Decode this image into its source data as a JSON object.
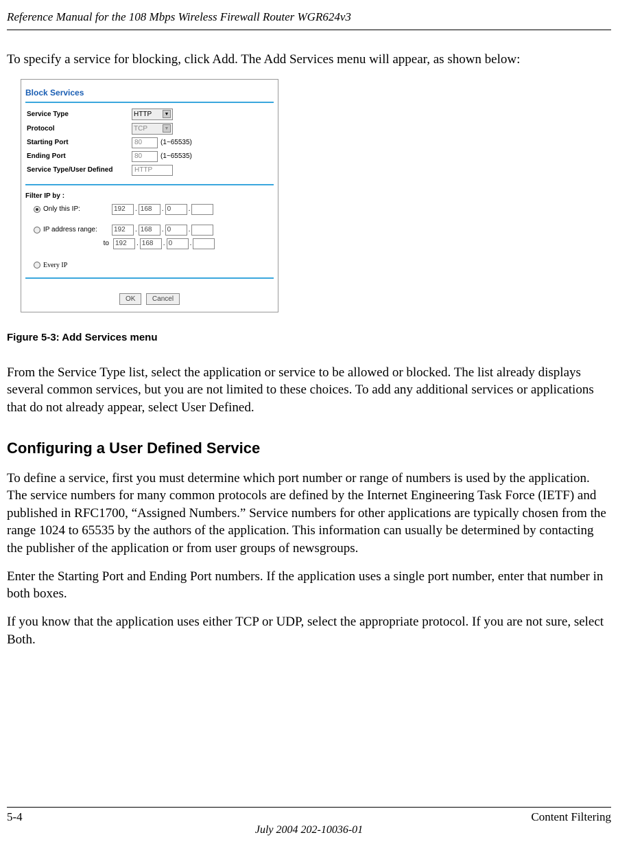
{
  "header": {
    "title": "Reference Manual for the 108 Mbps Wireless Firewall Router WGR624v3"
  },
  "intro_text": "To specify a service for blocking, click Add. The Add Services menu will appear, as shown below:",
  "figure": {
    "title": "Block Services",
    "rows": {
      "service_type": {
        "label": "Service Type",
        "value": "HTTP"
      },
      "protocol": {
        "label": "Protocol",
        "value": "TCP"
      },
      "starting_port": {
        "label": "Starting Port",
        "value": "80",
        "range": "(1~65535)"
      },
      "ending_port": {
        "label": "Ending Port",
        "value": "80",
        "range": "(1~65535)"
      },
      "user_defined": {
        "label": "Service Type/User Defined",
        "value": "HTTP"
      }
    },
    "filter": {
      "title": "Filter IP by :",
      "only_this": {
        "label": "Only this IP:",
        "oct1": "192",
        "oct2": "168",
        "oct3": "0",
        "oct4": ""
      },
      "range": {
        "label": "IP address range:",
        "from": {
          "oct1": "192",
          "oct2": "168",
          "oct3": "0",
          "oct4": ""
        },
        "to_label": "to",
        "to": {
          "oct1": "192",
          "oct2": "168",
          "oct3": "0",
          "oct4": ""
        }
      },
      "every": {
        "label": "Every IP"
      }
    },
    "buttons": {
      "ok": "OK",
      "cancel": "Cancel"
    }
  },
  "figure_caption": "Figure 5-3:  Add Services menu",
  "para_after_figure": "From the Service Type list, select the application or service to be allowed or blocked. The list already displays several common services, but you are not limited to these choices. To add any additional services or applications that do not already appear, select User Defined.",
  "section_heading": "Configuring a User Defined Service",
  "para_section_1": "To define a service, first you must determine which port number or range of numbers is used by the application. The service numbers for many common protocols are defined by the Internet Engineering Task Force (IETF) and published in RFC1700, “Assigned Numbers.” Service numbers for other applications are typically chosen from the range 1024 to 65535 by the authors of the application. This information can usually be determined by contacting the publisher of the application or from user groups of newsgroups.",
  "para_section_2": "Enter the Starting Port and Ending Port numbers. If the application uses a single port number, enter that number in both boxes.",
  "para_section_3": "If you know that the application uses either TCP or UDP, select the appropriate protocol. If you are not sure, select Both.",
  "footer": {
    "page": "5-4",
    "section": "Content Filtering",
    "date": "July 2004 202-10036-01"
  }
}
